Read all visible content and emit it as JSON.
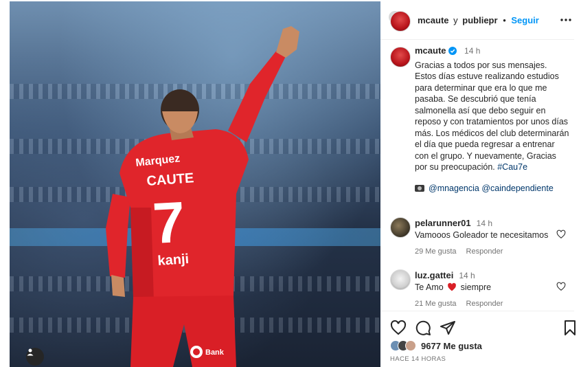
{
  "header": {
    "user1": "mcaute",
    "connector": "y",
    "user2": "publiepr",
    "separator": "•",
    "follow_label": "Seguir",
    "more_icon": "more-horizontal-icon"
  },
  "photo": {
    "jersey_sponsor": "Marquez",
    "jersey_name": "CAUTE",
    "jersey_number": "7",
    "jersey_brand": "kanji",
    "shorts_sponsor": "Bank",
    "colors": {
      "jersey": "#e0252b",
      "jersey_dark": "#b5151c",
      "skin": "#c98b63"
    }
  },
  "caption": {
    "username": "mcaute",
    "time": "14 h",
    "text": "Gracias a todos por sus mensajes. Estos días estuve realizando estudios para determinar que era lo que me pasaba. Se descubrió que tenía salmonella así que debo seguir en reposo y con tratamientos por unos días más. Los médicos del club determinarán el día que pueda regresar a entrenar con el grupo. Y nuevamente, Gracias por su preocupación.",
    "hashtag": "#Cau7e",
    "credit1": "@mnagencia",
    "credit2": "@caindependiente"
  },
  "comments": [
    {
      "username": "pelarunner01",
      "time": "14 h",
      "text": "Vamooos Goleador te necesitamos",
      "likes": "29 Me gusta",
      "reply": "Responder"
    },
    {
      "username": "luz.gattei",
      "time": "14 h",
      "text_before": "Te Amo",
      "text_after": "siempre",
      "likes": "21 Me gusta",
      "reply": "Responder"
    }
  ],
  "actions": {
    "likes_count": "9677 Me gusta",
    "posted_ago": "HACE 14 HORAS"
  },
  "colors": {
    "link": "#0095f6",
    "mention": "#00376b",
    "muted": "#737373",
    "heart": "#ed4956"
  }
}
